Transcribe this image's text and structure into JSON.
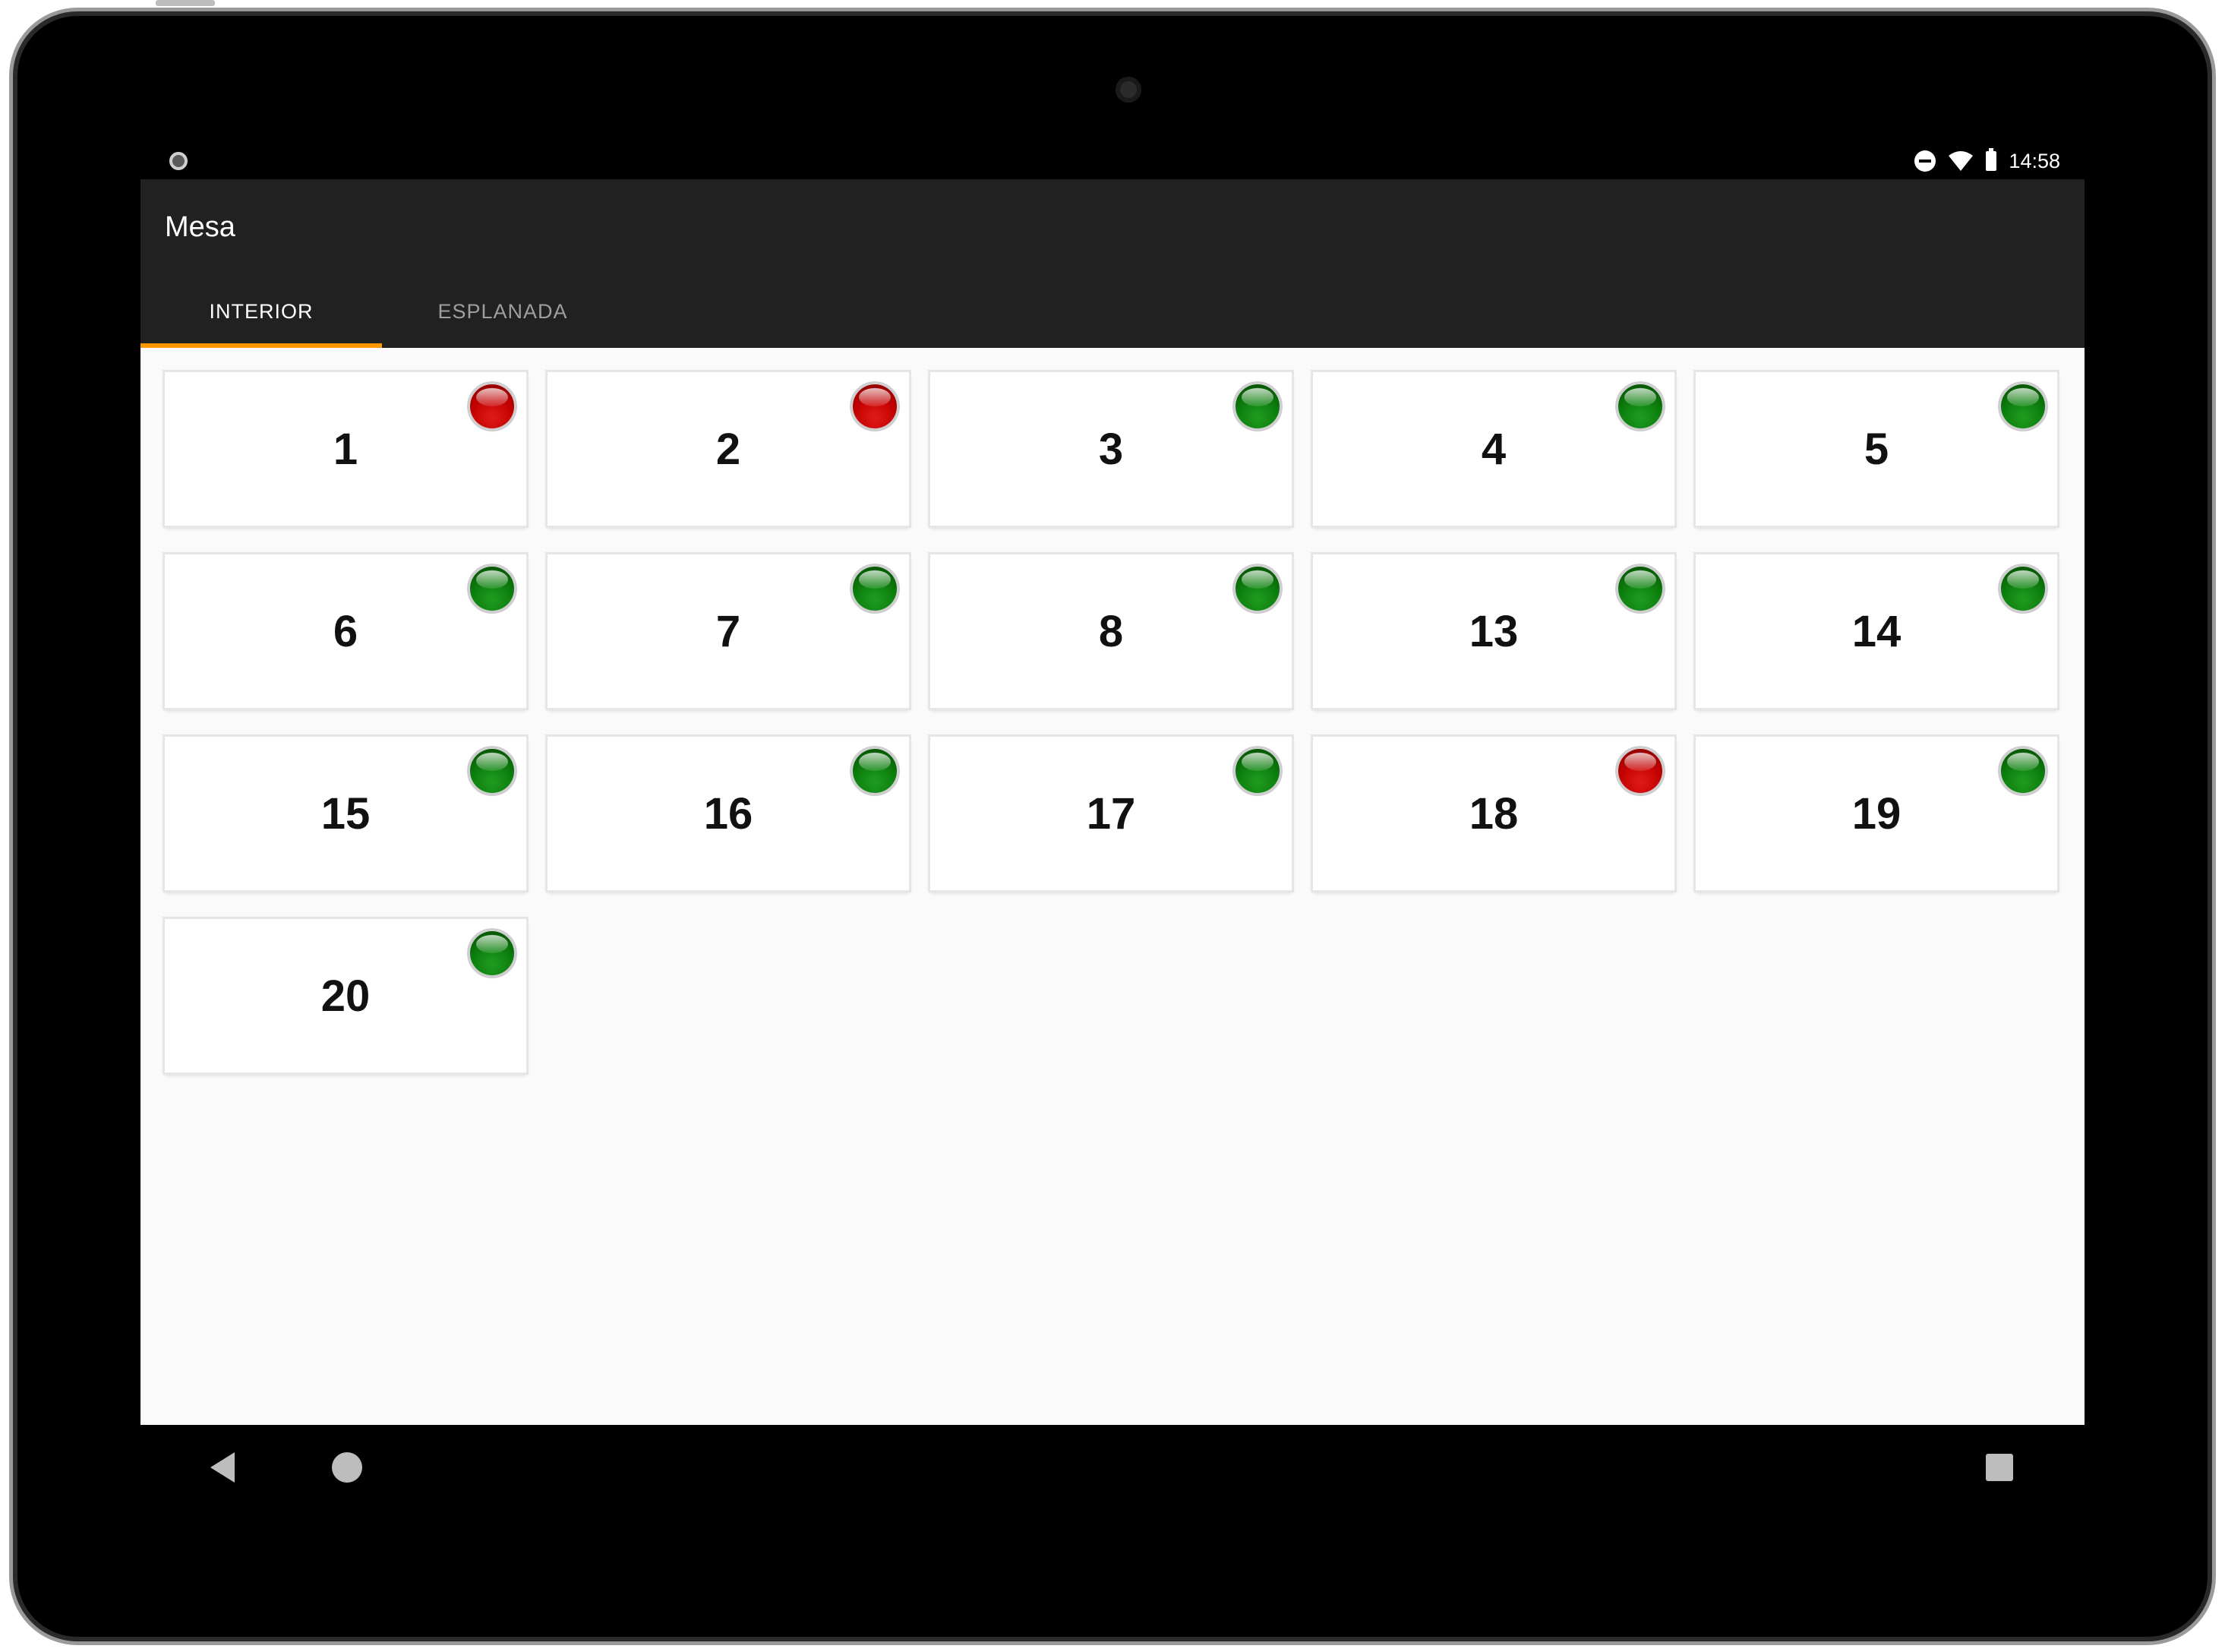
{
  "status_bar": {
    "time": "14:58",
    "icons": [
      "dnd-icon",
      "wifi-icon",
      "battery-icon"
    ]
  },
  "app_bar": {
    "title": "Mesa"
  },
  "tabs": [
    {
      "label": "INTERIOR",
      "active": true
    },
    {
      "label": "ESPLANADA",
      "active": false
    }
  ],
  "colors": {
    "tab_indicator": "#ff9800",
    "app_bar": "#212121",
    "occupied": "#c00000",
    "free": "#0b7a0b"
  },
  "tables": [
    {
      "number": "1",
      "status": "occupied"
    },
    {
      "number": "2",
      "status": "occupied"
    },
    {
      "number": "3",
      "status": "free"
    },
    {
      "number": "4",
      "status": "free"
    },
    {
      "number": "5",
      "status": "free"
    },
    {
      "number": "6",
      "status": "free"
    },
    {
      "number": "7",
      "status": "free"
    },
    {
      "number": "8",
      "status": "free"
    },
    {
      "number": "13",
      "status": "free"
    },
    {
      "number": "14",
      "status": "free"
    },
    {
      "number": "15",
      "status": "free"
    },
    {
      "number": "16",
      "status": "free"
    },
    {
      "number": "17",
      "status": "free"
    },
    {
      "number": "18",
      "status": "occupied"
    },
    {
      "number": "19",
      "status": "free"
    },
    {
      "number": "20",
      "status": "free"
    }
  ],
  "nav_bar": {
    "icons": [
      "back-icon",
      "home-icon",
      "recents-icon"
    ]
  }
}
